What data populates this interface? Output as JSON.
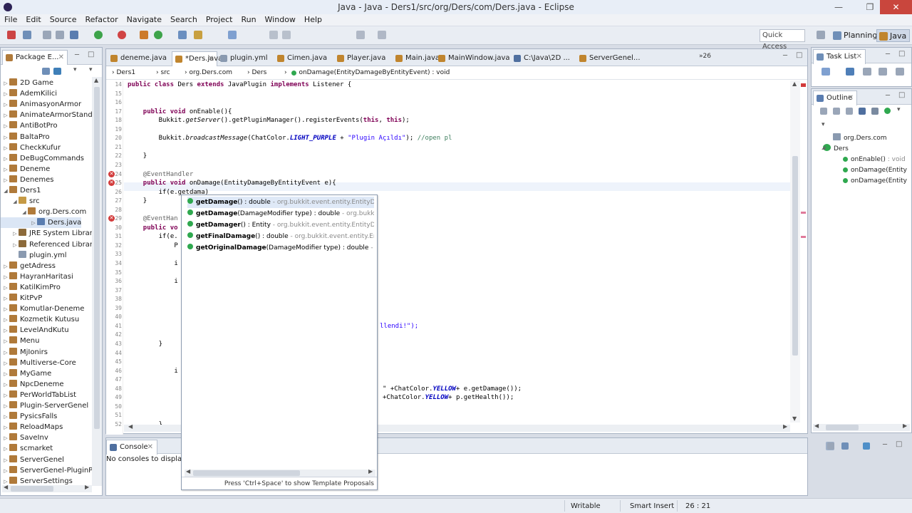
{
  "window": {
    "title": "Java - Java - Ders1/src/org/Ders/com/Ders.java - Eclipse"
  },
  "menu": [
    "File",
    "Edit",
    "Source",
    "Refactor",
    "Navigate",
    "Search",
    "Project",
    "Run",
    "Window",
    "Help"
  ],
  "toolbar": {
    "quick_access": "Quick Access",
    "perspectives": [
      "Planning",
      "Java"
    ]
  },
  "package_explorer": {
    "title": "Package E...",
    "items": [
      {
        "label": "2D Game",
        "level": 0
      },
      {
        "label": "AdemKilici",
        "level": 0
      },
      {
        "label": "AnimasyonArmor",
        "level": 0
      },
      {
        "label": "AnimateArmorStand",
        "level": 0
      },
      {
        "label": "AntiBotPro",
        "level": 0
      },
      {
        "label": "BaltaPro",
        "level": 0
      },
      {
        "label": "CheckKufur",
        "level": 0
      },
      {
        "label": "DeBugCommands",
        "level": 0
      },
      {
        "label": "Deneme",
        "level": 0
      },
      {
        "label": "Denemes",
        "level": 0
      },
      {
        "label": "Ders1",
        "level": 0
      },
      {
        "label": "src",
        "level": 1
      },
      {
        "label": "org.Ders.com",
        "level": 2
      },
      {
        "label": "Ders.java",
        "level": 3
      },
      {
        "label": "JRE System Librar",
        "level": 1
      },
      {
        "label": "Referenced Librar",
        "level": 1
      },
      {
        "label": "plugin.yml",
        "level": 1
      },
      {
        "label": "getAdress",
        "level": 0
      },
      {
        "label": "HayranHaritasi",
        "level": 0
      },
      {
        "label": "KatilKimPro",
        "level": 0
      },
      {
        "label": "KitPvP",
        "level": 0
      },
      {
        "label": "Komutlar-Deneme",
        "level": 0
      },
      {
        "label": "Kozmetik Kutusu",
        "level": 0
      },
      {
        "label": "LevelAndKutu",
        "level": 0
      },
      {
        "label": "Menu",
        "level": 0
      },
      {
        "label": "MjIonirs",
        "level": 0
      },
      {
        "label": "Multiverse-Core",
        "level": 0
      },
      {
        "label": "MyGame",
        "level": 0
      },
      {
        "label": "NpcDeneme",
        "level": 0
      },
      {
        "label": "PerWorldTabList",
        "level": 0
      },
      {
        "label": "Plugin-ServerGenel",
        "level": 0
      },
      {
        "label": "PysicsFalls",
        "level": 0
      },
      {
        "label": "ReloadMaps",
        "level": 0
      },
      {
        "label": "SaveInv",
        "level": 0
      },
      {
        "label": "scmarket",
        "level": 0
      },
      {
        "label": "ServerGenel",
        "level": 0
      },
      {
        "label": "ServerGenel-PluginP",
        "level": 0
      },
      {
        "label": "ServerSettings",
        "level": 0
      }
    ]
  },
  "editor_tabs": [
    {
      "label": "deneme.java",
      "active": false
    },
    {
      "label": "*Ders.java",
      "active": true
    },
    {
      "label": "plugin.yml",
      "active": false
    },
    {
      "label": "Cimen.java",
      "active": false
    },
    {
      "label": "Player.java",
      "active": false
    },
    {
      "label": "Main.java",
      "active": false
    },
    {
      "label": "MainWindow.java",
      "active": false
    },
    {
      "label": "C:\\Java\\2D ...",
      "active": false
    },
    {
      "label": "ServerGenel...",
      "active": false
    }
  ],
  "editor_overflow": "26",
  "breadcrumb": [
    "Ders1",
    "src",
    "org.Ders.com",
    "Ders",
    "onDamage(EntityDamageByEntityEvent) : void"
  ],
  "line_numbers": [
    "14",
    "15",
    "16",
    "17",
    "18",
    "19",
    "20",
    "21",
    "22",
    "23",
    "24",
    "25",
    "26",
    "27",
    "28",
    "29",
    "30",
    "31",
    "32",
    "33",
    "34",
    "35",
    "36",
    "37",
    "38",
    "39",
    "40",
    "41",
    "42",
    "43",
    "44",
    "45",
    "46",
    "47",
    "48",
    "49",
    "50",
    "51",
    "52"
  ],
  "code": {
    "l14_a": "public class ",
    "l14_b": "Ders ",
    "l14_c": "extends ",
    "l14_d": "JavaPlugin ",
    "l14_e": "implements ",
    "l14_f": "Listener {",
    "l17_a": "public void ",
    "l17_b": "onEnable(){",
    "l18_a": "Bukkit.",
    "l18_b": "getServer",
    "l18_c": "().getPluginManager().registerEvents(",
    "l18_d": "this",
    "l18_e": ", ",
    "l18_f": "this",
    "l18_g": ");",
    "l20_a": "Bukkit.",
    "l20_b": "broadcastMessage",
    "l20_c": "(ChatColor.",
    "l20_d": "LIGHT_PURPLE",
    "l20_e": " + ",
    "l20_f": "\"Plugin Açıldı\"",
    "l20_g": "); ",
    "l20_h": "//open pl",
    "l22": "}",
    "l24": "@EventHandler",
    "l25_a": "public void ",
    "l25_b": "onDamage(EntityDamageByEntityEvent e){",
    "l26": "if(e.getdama)",
    "l27": "}",
    "l29": "@EventHan",
    "l30_a": "public vo",
    "l31": "if(e.",
    "l32": "P",
    "l34": "i",
    "l36": "i",
    "l41": "llendi!\");",
    "l43": "}",
    "l46": "i",
    "l48_a": "\" +ChatColor.",
    "l48_b": "YELLOW",
    "l48_c": "+ e.getDamage());",
    "l49_a": "+ChatColor.",
    "l49_b": "YELLOW",
    "l49_c": "+ p.getHealth());",
    "l52": "}"
  },
  "content_assist": {
    "proposals": [
      {
        "name": "getDamage",
        "sig": "() : double",
        "qual": " - org.bukkit.event.entity.EntityDamag"
      },
      {
        "name": "getDamage",
        "sig": "(DamageModifier type) : double",
        "qual": " - org.bukkit.eve"
      },
      {
        "name": "getDamager",
        "sig": "() : Entity",
        "qual": " - org.bukkit.event.entity.EntityDamag"
      },
      {
        "name": "getFinalDamage",
        "sig": "() : double",
        "qual": " - org.bukkit.event.entity.EntityDa"
      },
      {
        "name": "getOriginalDamage",
        "sig": "(DamageModifier type) : double",
        "qual": " - org.bu"
      }
    ],
    "footer": "Press 'Ctrl+Space' to show Template Proposals"
  },
  "task_list": {
    "title": "Task List"
  },
  "outline": {
    "title": "Outline",
    "items": [
      {
        "label": "org.Ders.com",
        "sub": ""
      },
      {
        "label": "Ders",
        "sub": ""
      },
      {
        "label": "onEnable()",
        "sub": " : void"
      },
      {
        "label": "onDamage(Entity",
        "sub": ""
      },
      {
        "label": "onDamage(Entity",
        "sub": ""
      }
    ]
  },
  "console": {
    "title": "Console",
    "message": "No consoles to display a"
  },
  "status": {
    "writable": "Writable",
    "insert_mode": "Smart Insert",
    "position": "26 : 21"
  },
  "colors": {
    "error": "#d23b3b",
    "keyword": "#7f0055",
    "string": "#2a00ff",
    "comment": "#3f7f5f"
  }
}
